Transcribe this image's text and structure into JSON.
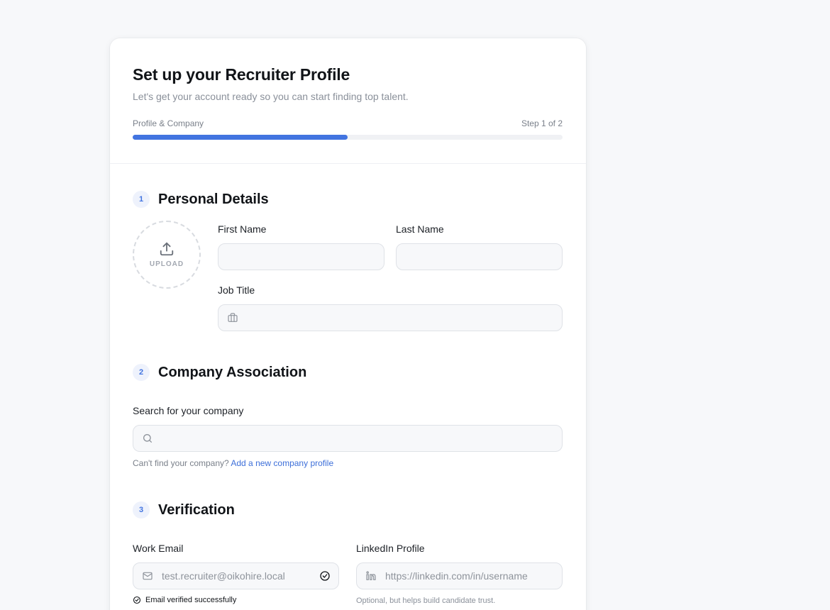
{
  "header": {
    "title": "Set up your Recruiter Profile",
    "subtitle": "Let's get your account ready so you can start finding top talent.",
    "step_label": "Profile & Company",
    "step_count": "Step 1 of 2",
    "progress": 0.5
  },
  "personal": {
    "number": "1",
    "title": "Personal Details",
    "upload_label": "UPLOAD",
    "first_name_label": "First Name",
    "last_name_label": "Last Name",
    "job_title_label": "Job Title"
  },
  "company": {
    "number": "2",
    "title": "Company Association",
    "search_label": "Search for your company",
    "helper_text": "Can't find your company?",
    "helper_link": "Add a new company profile"
  },
  "verification": {
    "number": "3",
    "title": "Verification",
    "email_label": "Work Email",
    "email_value": "test.recruiter@oikohire.local",
    "email_status": "Email verified successfully",
    "linkedin_label": "LinkedIn Profile",
    "linkedin_placeholder": "https://linkedin.com/in/username",
    "linkedin_helper": "Optional, but helps build candidate trust."
  },
  "colors": {
    "accent": "#4274e0",
    "background": "#f7f8fa",
    "card": "#ffffff"
  },
  "icons": {
    "upload": "upload-icon",
    "job_title": "briefcase-icon",
    "search": "search-icon",
    "email": "mail-icon",
    "email_verified": "check-circle-icon",
    "linkedin": "linkedin-icon"
  }
}
